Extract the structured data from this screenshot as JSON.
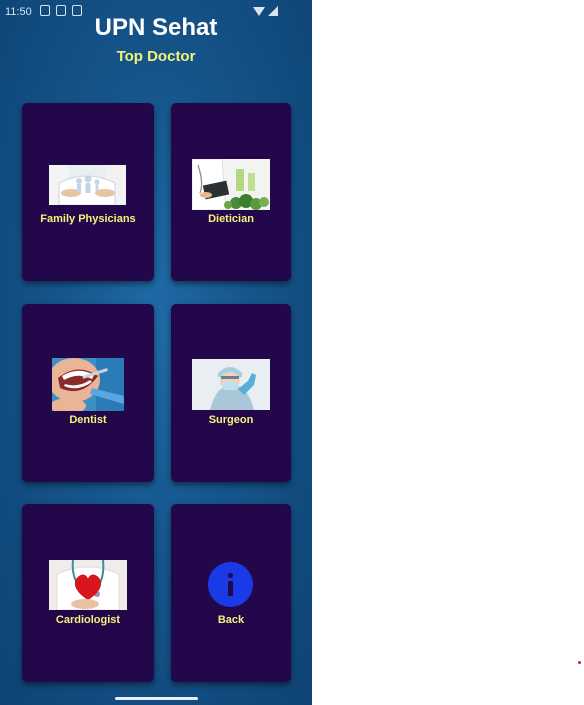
{
  "status_bar": {
    "time": "11:50"
  },
  "header": {
    "title": "UPN Sehat",
    "subtitle": "Top Doctor"
  },
  "cards": [
    {
      "label": "Family Physicians",
      "icon": "family-physician-photo"
    },
    {
      "label": "Dietician",
      "icon": "dietician-photo"
    },
    {
      "label": "Dentist",
      "icon": "dentist-photo"
    },
    {
      "label": "Surgeon",
      "icon": "surgeon-photo"
    },
    {
      "label": "Cardiologist",
      "icon": "cardiologist-photo"
    },
    {
      "label": "Back",
      "icon": "info-icon"
    }
  ],
  "colors": {
    "background": "#15548a",
    "card": "#22084a",
    "label": "#f5f27a",
    "back_button": "#1a3ae8"
  }
}
